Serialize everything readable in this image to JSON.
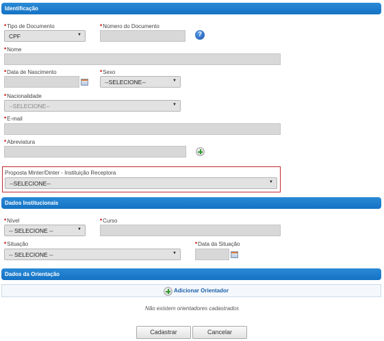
{
  "sections": {
    "identificacao": "Identificação",
    "dados_institucionais": "Dados Institucionais",
    "dados_orientacao": "Dados da Orientação"
  },
  "identificacao": {
    "tipo_documento": {
      "label": "Tipo de Documento",
      "value": "CPF"
    },
    "numero_documento": {
      "label": "Número do Documento",
      "value": ""
    },
    "nome": {
      "label": "Nome",
      "value": ""
    },
    "data_nascimento": {
      "label": "Data de Nascimento",
      "value": ""
    },
    "sexo": {
      "label": "Sexo",
      "value": "--SELECIONE--"
    },
    "nacionalidade": {
      "label": "Nacionalidade",
      "value": "--SELECIONE--"
    },
    "email": {
      "label": "E-mail",
      "value": ""
    },
    "abreviatura": {
      "label": "Abreviatura",
      "value": ""
    },
    "proposta": {
      "label": "Proposta Minter/Dinter - Instituição Receptora",
      "value": "--SELECIONE--"
    }
  },
  "institucionais": {
    "nivel": {
      "label": "Nível",
      "value": "-- SELECIONE --"
    },
    "curso": {
      "label": "Curso",
      "value": ""
    },
    "situacao": {
      "label": "Situação",
      "value": "-- SELECIONE --"
    },
    "data_situacao": {
      "label": "Data da Situação",
      "value": ""
    }
  },
  "orientacao": {
    "add_label": "Adicionar Orientador",
    "empty_message": "Não existem orientadores cadastrados"
  },
  "buttons": {
    "cadastrar": "Cadastrar",
    "cancelar": "Cancelar"
  },
  "icons": {
    "help": "question-circle-icon",
    "add": "plus-circle-icon",
    "calendar": "calendar-icon"
  },
  "colors": {
    "header_blue": "#1a7bcc",
    "required_red": "#cc0000",
    "highlight_border": "#c0272d",
    "link_blue": "#1a5fa8"
  }
}
